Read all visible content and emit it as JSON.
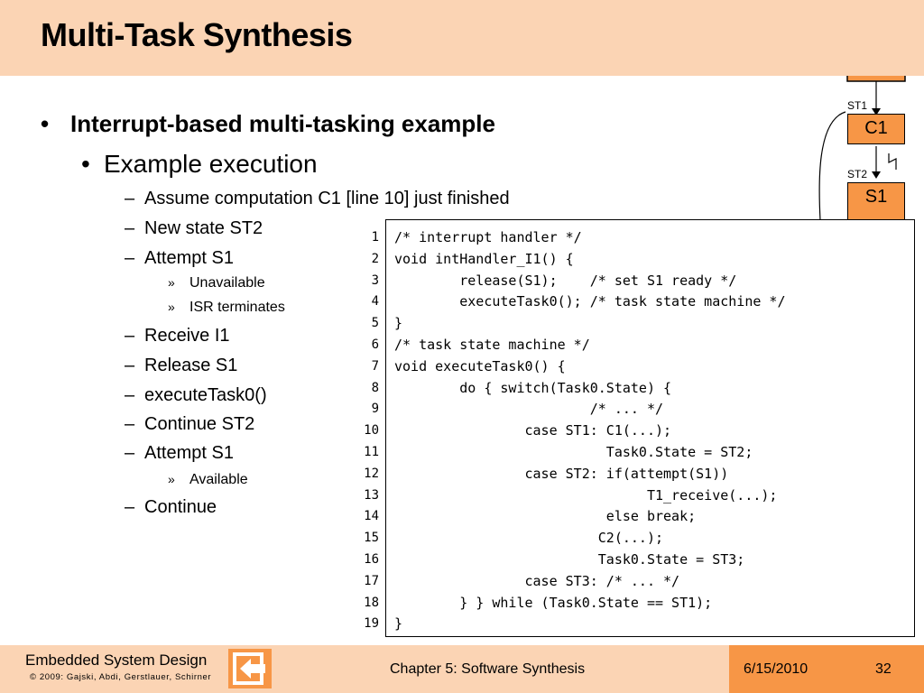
{
  "slide": {
    "title": "Multi-Task Synthesis"
  },
  "bullets": {
    "level1": "Interrupt-based multi-tasking example",
    "level2": "Example execution",
    "items": [
      "Assume computation C1 [line 10] just finished",
      "New state ST2",
      "Attempt S1",
      "Unavailable",
      "ISR terminates",
      "Receive I1",
      "Release S1",
      "executeTask0()",
      "Continue ST2",
      "Attempt S1",
      "Available",
      "Continue"
    ],
    "markers": {
      "level1": "•",
      "level2": "•",
      "level3": "–",
      "level4": "»"
    }
  },
  "diagram": {
    "state_labels": [
      "ST1",
      "ST2"
    ],
    "boxes": [
      "C1",
      "S1"
    ],
    "colors": {
      "box_fill": "#f79646",
      "stroke": "#000000"
    }
  },
  "code": {
    "line_numbers": [
      "1",
      "2",
      "3",
      "4",
      "5",
      "6",
      "7",
      "8",
      "9",
      "10",
      "11",
      "12",
      "13",
      "14",
      "15",
      "16",
      "17",
      "18",
      "19"
    ],
    "lines": [
      "/* interrupt handler */",
      "void intHandler_I1() {",
      "        release(S1);    /* set S1 ready */",
      "        executeTask0(); /* task state machine */",
      "}",
      "/* task state machine */",
      "void executeTask0() {",
      "        do { switch(Task0.State) {",
      "                        /* ... */",
      "                case ST1: C1(...);",
      "                          Task0.State = ST2;",
      "                case ST2: if(attempt(S1))",
      "                               T1_receive(...);",
      "                          else break;",
      "                         C2(...);",
      "                         Task0.State = ST3;",
      "                case ST3: /* ... */",
      "        } } while (Task0.State == ST1);",
      "}"
    ]
  },
  "footer": {
    "book_title": "Embedded System Design",
    "copyright": "© 2009: Gajski, Abdi, Gerstlauer, Schirner",
    "chapter": "Chapter 5: Software Synthesis",
    "date": "6/15/2010",
    "page": "32"
  },
  "colors": {
    "header_bg": "#fbd4b4",
    "footer_bg": "#fbd4b4",
    "accent": "#f79646"
  }
}
